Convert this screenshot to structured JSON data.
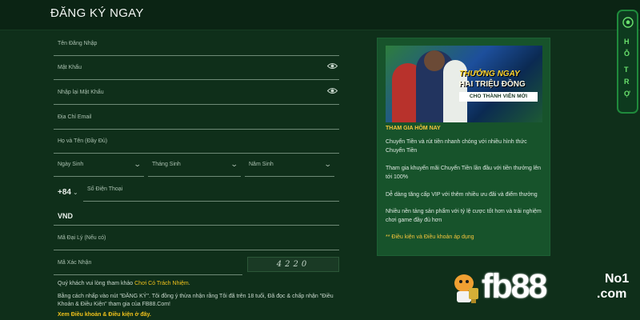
{
  "header": {
    "title": "ĐĂNG KÝ NGAY"
  },
  "form": {
    "username_placeholder": "Tên Đăng Nhập",
    "password_placeholder": "Mật Khẩu",
    "confirm_password_placeholder": "Nhập lại Mật Khẩu",
    "email_placeholder": "Địa Chỉ Email",
    "fullname_placeholder": "Họ và Tên (Đầy Đủ)",
    "birth_day_placeholder": "Ngày Sinh",
    "birth_month_placeholder": "Tháng Sinh",
    "birth_year_placeholder": "Năm Sinh",
    "phone_prefix": "+84",
    "phone_placeholder": "Số Điện Thoại",
    "currency": "VND",
    "agent_code_placeholder": "Mã Đại Lý (Nếu có)",
    "captcha_placeholder": "Mã Xác Nhận",
    "captcha_code": "4220"
  },
  "notes": {
    "responsible_prefix": "Quý khách vui lòng tham khảo ",
    "responsible_link": "Chơi Có Trách Nhiệm",
    "responsible_suffix": ".",
    "agree_line1_a": "Bằng cách nhấp vào nút ",
    "agree_line1_b": "\"ĐĂNG KÝ\"",
    "agree_line1_c": ". Tôi đồng ý thừa nhận rằng Tôi đã trên 18 tuổi, Đã đọc & chấp nhận \"Điều",
    "agree_line2": "Khoản & Điều Kiện\" tham gia của FB88.Com!",
    "terms_link": "Xem Điều khoản & Điều kiện ở đây."
  },
  "promo": {
    "banner_line1": "THƯỞNG NGAY",
    "banner_line2": "HAI TRIỆU ĐỒNG",
    "banner_line3": "CHO THÀNH VIÊN MỚI",
    "title": "THAM GIA HÔM NAY",
    "paragraphs": [
      "Chuyển Tiền và rút tiền nhanh chóng với nhiều hình thức Chuyển Tiền",
      "Tham gia khuyến mãi Chuyển Tiền lần đầu với tiền thưởng lên tới 100%",
      "Dễ dàng tăng cấp VIP với thêm nhiều ưu đãi và điểm thưởng",
      "Nhiều nền tảng sản phẩm với tỷ lệ cược tốt hơn và trải nghiệm chơi game đầy đủ hơn"
    ],
    "terms": "** Điều kiện và Điều khoản áp dụng"
  },
  "side_tab": {
    "letters": [
      "H",
      "Ỗ",
      "T",
      "R",
      "Ợ"
    ]
  },
  "logo": {
    "brand": "fb88",
    "badge": "No1",
    "domain": ".com"
  },
  "colors": {
    "background": "#0f2f1a",
    "header_bg": "#0b2414",
    "promo_bg": "#17532b",
    "accent_yellow": "#f1c21b",
    "side_tab_green": "#69e06d"
  }
}
